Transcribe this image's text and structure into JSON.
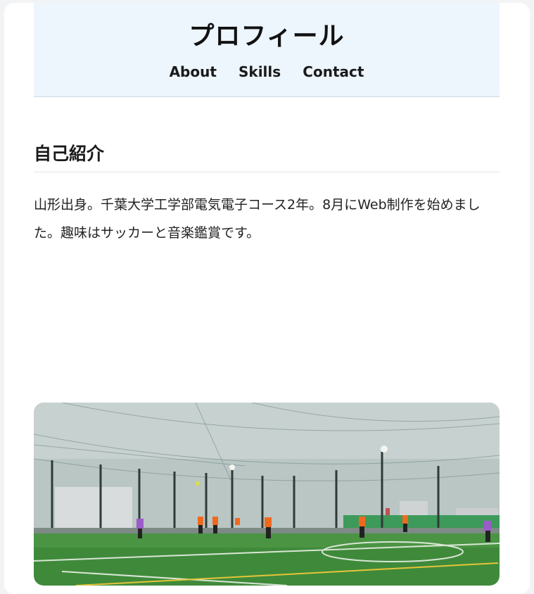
{
  "header": {
    "title": "プロフィール",
    "nav": [
      {
        "label": "About"
      },
      {
        "label": "Skills"
      },
      {
        "label": "Contact"
      }
    ]
  },
  "intro": {
    "heading": "自己紹介",
    "text": "山形出身。千葉大学工学部電気電子コース2年。8月にWeb制作を始めました。趣味はサッカーと音楽鑑賞です。"
  },
  "colors": {
    "header_bg": "#edf5fd",
    "pitch": "#3f8a3a",
    "sky": "#b7c4c3",
    "bib_orange": "#f06a1e",
    "bib_purple": "#9b5bc9"
  }
}
